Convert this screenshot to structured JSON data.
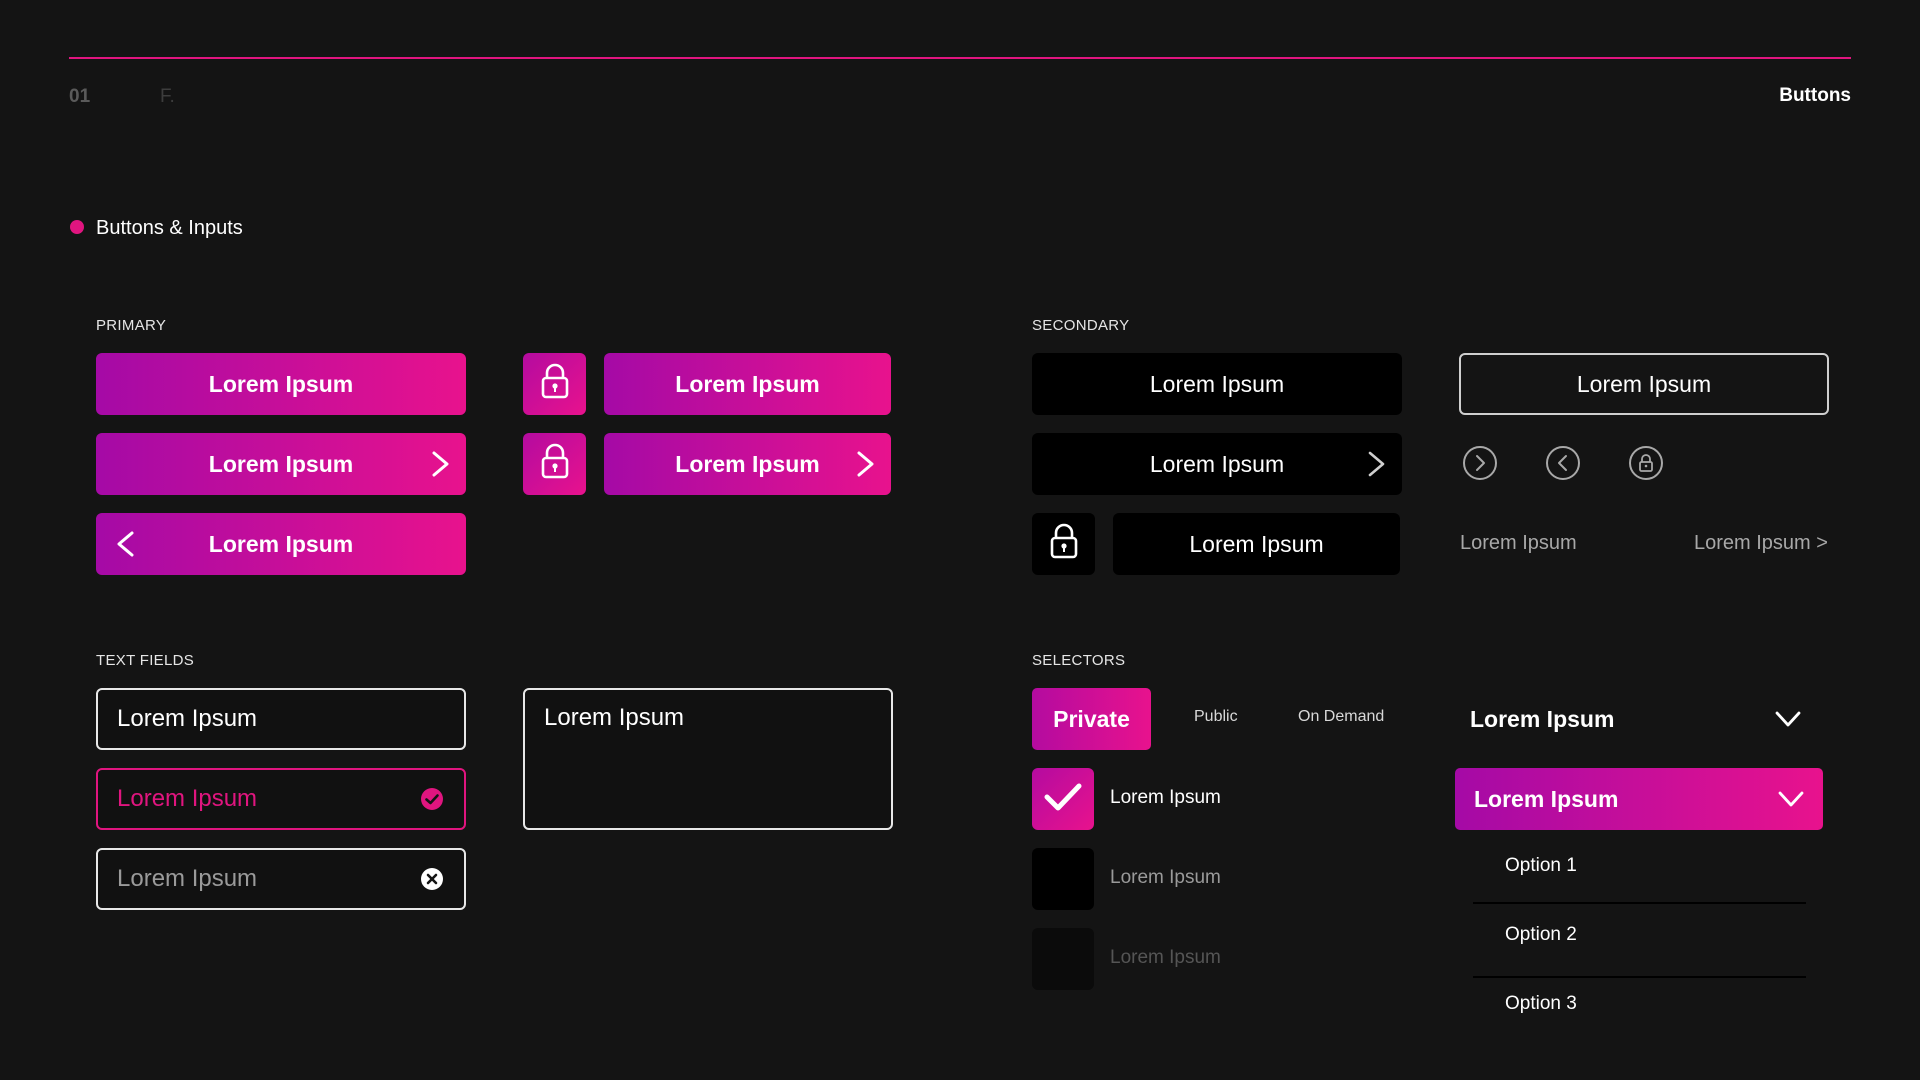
{
  "header": {
    "page_number": "01",
    "page_letter": "F.",
    "title": "Buttons"
  },
  "section": {
    "title": "Buttons & Inputs"
  },
  "primary": {
    "label": "PRIMARY",
    "button_1": "Lorem Ipsum",
    "button_2": "Lorem Ipsum",
    "button_3": "Lorem Ipsum",
    "lock_button_1": "Lorem Ipsum",
    "lock_button_2": "Lorem Ipsum"
  },
  "secondary": {
    "label": "SECONDARY",
    "dark_button_1": "Lorem Ipsum",
    "dark_button_2": "Lorem Ipsum",
    "dark_lock_button": "Lorem Ipsum",
    "outline_button": "Lorem Ipsum",
    "text_link_1": "Lorem Ipsum",
    "text_link_2": "Lorem Ipsum >"
  },
  "text_fields": {
    "label": "TEXT FIELDS",
    "field_default": "Lorem Ipsum",
    "field_valid": "Lorem Ipsum",
    "field_error": "Lorem Ipsum",
    "textarea": "Lorem Ipsum"
  },
  "selectors": {
    "label": "SELECTORS",
    "segments": [
      "Private",
      "Public",
      "On Demand"
    ],
    "checkboxes": [
      {
        "label": "Lorem Ipsum",
        "state": "checked"
      },
      {
        "label": "Lorem Ipsum",
        "state": "unchecked"
      },
      {
        "label": "Lorem Ipsum",
        "state": "disabled"
      }
    ],
    "dropdown_closed": "Lorem Ipsum",
    "dropdown_open": "Lorem Ipsum",
    "options": [
      "Option 1",
      "Option 2",
      "Option 3"
    ]
  },
  "colors": {
    "background": "#141414",
    "accent": "#e0157f",
    "gradient_start": "#a50aa6",
    "gradient_end": "#e8128d"
  },
  "icons": {
    "lock": "lock-icon",
    "chevron_right": "chevron-right-icon",
    "chevron_left": "chevron-left-icon",
    "chevron_down": "chevron-down-icon",
    "check": "check-icon",
    "check_circle": "check-circle-icon",
    "clear_circle": "clear-circle-icon"
  }
}
